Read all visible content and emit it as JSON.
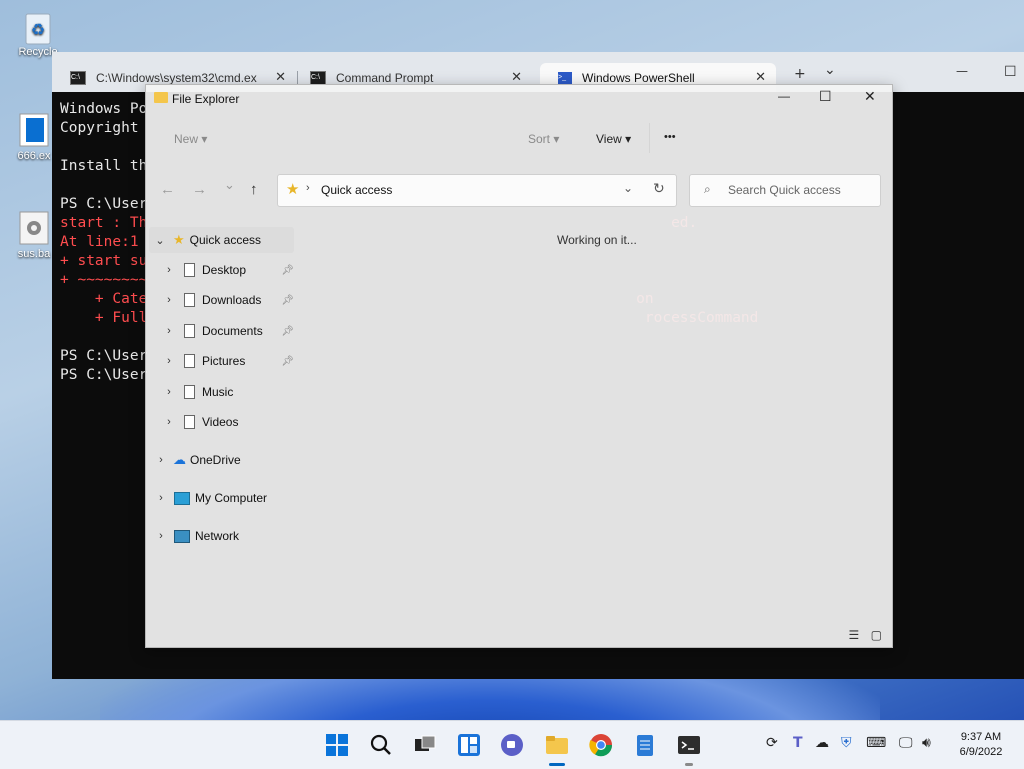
{
  "desktop": {
    "icons": [
      {
        "label": "Recycle"
      },
      {
        "label": "666.ex"
      },
      {
        "label": "sus.ba"
      }
    ]
  },
  "terminal": {
    "tabs": [
      {
        "label": "C:\\Windows\\system32\\cmd.ex",
        "close": "✕"
      },
      {
        "label": "Command Prompt",
        "close": "✕"
      },
      {
        "label": "Windows PowerShell",
        "close": "✕"
      }
    ],
    "new_tab": "+",
    "dropdown": "⌄",
    "minimize": "—",
    "maximize": "☐",
    "lines": [
      {
        "text": "Windows Po",
        "type": "normal"
      },
      {
        "text": "Copyright",
        "type": "normal"
      },
      {
        "text": "",
        "type": "normal"
      },
      {
        "text": "Install th",
        "type": "normal"
      },
      {
        "text": "",
        "type": "normal"
      },
      {
        "text": "PS C:\\User",
        "type": "normal"
      },
      {
        "text": "start : Th                                                            ed.",
        "type": "err"
      },
      {
        "text": "At line:1",
        "type": "err"
      },
      {
        "text": "+ start su",
        "type": "err"
      },
      {
        "text": "+ ~~~~~~~~",
        "type": "err"
      },
      {
        "text": "    + Cate                                                        on",
        "type": "err"
      },
      {
        "text": "    + Full                                                         rocessCommand",
        "type": "err"
      },
      {
        "text": "",
        "type": "normal"
      },
      {
        "text": "PS C:\\User",
        "type": "normal"
      },
      {
        "text": "PS C:\\User",
        "type": "normal"
      }
    ]
  },
  "explorer": {
    "title": "File Explorer",
    "minimize": "—",
    "maximize": "☐",
    "close": "✕",
    "commands": {
      "new": "New ▾",
      "sort": "Sort ▾",
      "view": "View ▾",
      "more": "•••"
    },
    "nav": {
      "back": "←",
      "forward": "→",
      "recent": "⌄",
      "up": "↑"
    },
    "address": {
      "text": "Quick access",
      "chevron": "›",
      "dropdown": "⌄",
      "refresh": "↻"
    },
    "search": {
      "placeholder": "Search Quick access",
      "icon": "⌕"
    },
    "status": "Working on it...",
    "tree": [
      {
        "label": "Quick access",
        "level": 0,
        "expanded": true,
        "selected": true,
        "icon": "star-icon"
      },
      {
        "label": "Desktop",
        "level": 1,
        "pinned": true,
        "icon": "document-icon"
      },
      {
        "label": "Downloads",
        "level": 1,
        "pinned": true,
        "icon": "document-icon"
      },
      {
        "label": "Documents",
        "level": 1,
        "pinned": true,
        "icon": "document-icon"
      },
      {
        "label": "Pictures",
        "level": 1,
        "pinned": true,
        "icon": "document-icon"
      },
      {
        "label": "Music",
        "level": 1,
        "pinned": false,
        "icon": "document-icon"
      },
      {
        "label": "Videos",
        "level": 1,
        "pinned": false,
        "icon": "document-icon"
      },
      {
        "label": "OneDrive",
        "level": 0,
        "icon": "cloud-icon"
      },
      {
        "label": "My Computer",
        "level": 0,
        "icon": "monitor-icon"
      },
      {
        "label": "Network",
        "level": 0,
        "icon": "network-icon"
      }
    ],
    "view_buttons": {
      "details": "☰",
      "tiles": "▢"
    }
  },
  "taskbar": {
    "apps": [
      "start-icon",
      "search-icon",
      "task-view-icon",
      "widgets-icon",
      "chat-icon",
      "file-explorer-icon",
      "chrome-icon",
      "notepad-icon",
      "terminal-icon"
    ],
    "tray": [
      "sync-icon",
      "teams-icon",
      "onedrive-offline-icon",
      "security-icon",
      "keyboard-icon",
      "network-icon",
      "volume-icon"
    ],
    "time": "9:37 AM",
    "date": "6/9/2022"
  },
  "colors": {
    "accent": "#0067c0",
    "error_text": "#ff4d4f",
    "terminal_bg": "#0c0c0c",
    "folder": "#f4c64c"
  }
}
